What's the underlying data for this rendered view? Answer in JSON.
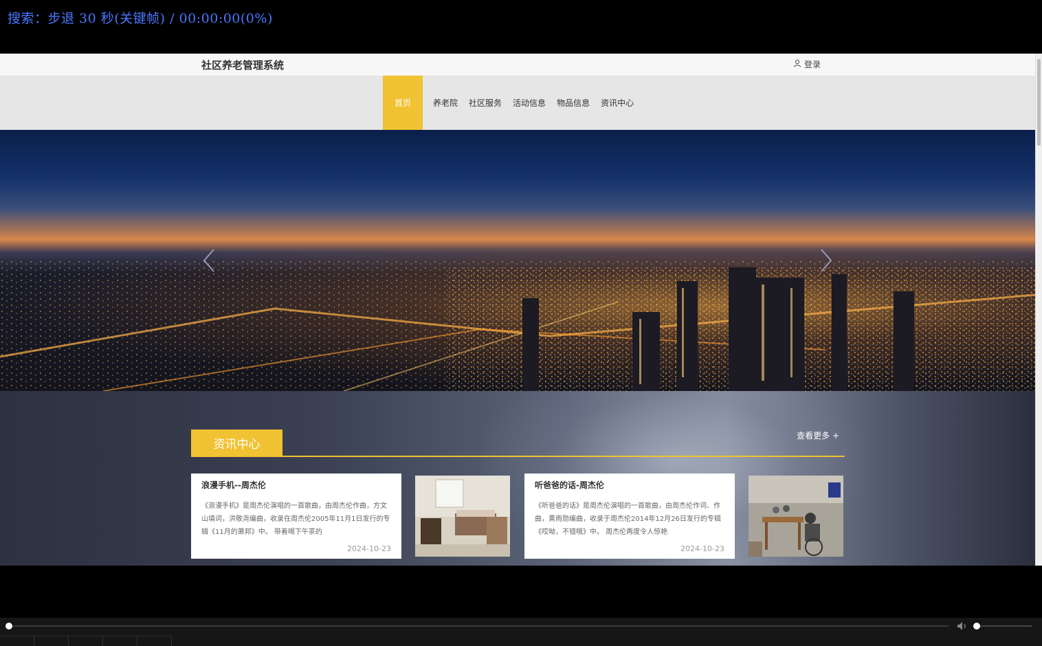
{
  "player": {
    "osd_text": "搜索：步退 30 秒(关键帧) / 00:00:00(0%)",
    "seek_progress_percent": 0,
    "volume_percent": 5
  },
  "site": {
    "title": "社区养老管理系统",
    "login_label": "登录",
    "login_icon": "user-icon"
  },
  "nav": {
    "items": [
      "首页",
      "养老院",
      "社区服务",
      "活动信息",
      "物品信息",
      "资讯中心"
    ],
    "active_index": 0,
    "active_color": "#f1c232"
  },
  "news": {
    "section_title": "资讯中心",
    "more_label": "查看更多 +",
    "accent_color": "#f1c232",
    "articles": [
      {
        "title": "浪漫手机--周杰伦",
        "excerpt": "《浪漫手机》是周杰伦演唱的一首歌曲，由周杰伦作曲，方文山填词，洪敬尧编曲，收录在周杰伦2005年11月1日发行的专辑《11月的萧邦》中。 带着喝下午茶的",
        "date": "2024-10-23"
      },
      {
        "title": "听爸爸的话-周杰伦",
        "excerpt": "《听爸爸的话》是周杰伦演唱的一首歌曲，由周杰伦作词、作曲，黄雨勋编曲，收录于周杰伦2014年12月26日发行的专辑《哎呦，不错哦》中。 周杰伦再度令人惊艳",
        "date": "2024-10-23"
      }
    ]
  }
}
